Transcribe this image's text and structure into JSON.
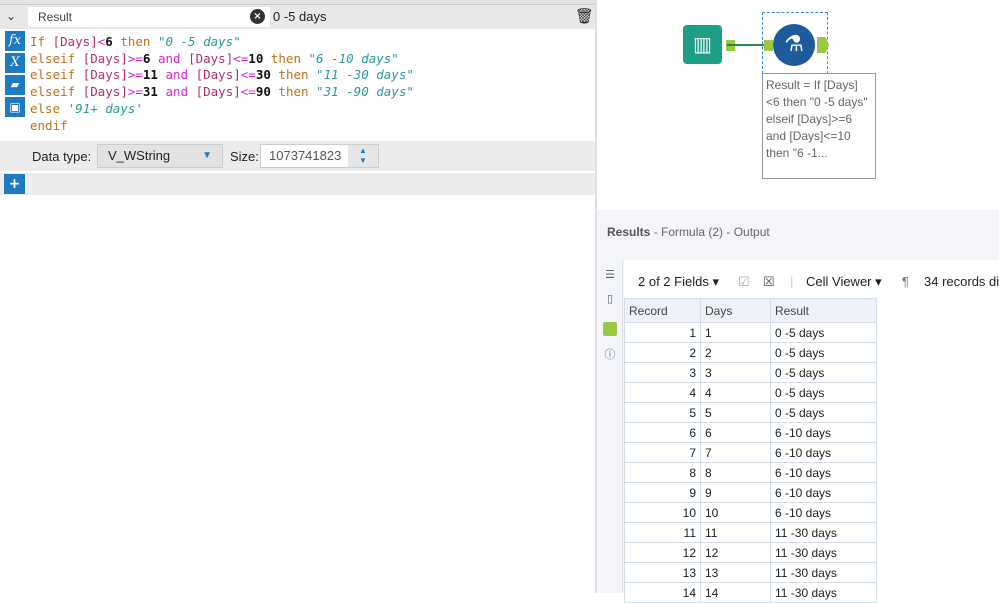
{
  "expression": {
    "field_name": "Result",
    "preview": "0 -5 days",
    "code": [
      [
        [
          "kw",
          "If "
        ],
        [
          "fld",
          "[Days]"
        ],
        [
          "op",
          "<"
        ],
        [
          "num",
          "6"
        ],
        [
          "kw",
          " then "
        ],
        [
          "str",
          "\"0 -5 days\""
        ]
      ],
      [
        [
          "kw",
          "elseif "
        ],
        [
          "fld",
          "[Days]"
        ],
        [
          "op",
          ">="
        ],
        [
          "num",
          "6"
        ],
        [
          "op",
          " and "
        ],
        [
          "fld",
          "[Days]"
        ],
        [
          "op",
          "<="
        ],
        [
          "num",
          "10"
        ],
        [
          "kw",
          " then "
        ],
        [
          "str",
          "\"6 -10 days\""
        ]
      ],
      [
        [
          "kw",
          "elseif "
        ],
        [
          "fld",
          "[Days]"
        ],
        [
          "op",
          ">="
        ],
        [
          "num",
          "11"
        ],
        [
          "op",
          " and "
        ],
        [
          "fld",
          "[Days]"
        ],
        [
          "op",
          "<="
        ],
        [
          "num",
          "30"
        ],
        [
          "kw",
          " then "
        ],
        [
          "str",
          "\"11 -30 days\""
        ]
      ],
      [
        [
          "kw",
          "elseif "
        ],
        [
          "fld",
          "[Days]"
        ],
        [
          "op",
          ">="
        ],
        [
          "num",
          "31"
        ],
        [
          "op",
          " and "
        ],
        [
          "fld",
          "[Days]"
        ],
        [
          "op",
          "<="
        ],
        [
          "num",
          "90"
        ],
        [
          "kw",
          " then "
        ],
        [
          "str",
          "\"31 -90 days\""
        ]
      ],
      [
        [
          "kw",
          "else "
        ],
        [
          "str",
          "'91+ days'"
        ]
      ],
      [
        [
          "kw",
          "endif"
        ]
      ]
    ],
    "data_type_label": "Data type:",
    "data_type": "V_WString",
    "size_label": "Size:",
    "size": "1073741823"
  },
  "canvas": {
    "annotation": "Result = If [Days] <6 then \"0 -5 days\" elseif [Days]>=6 and [Days]<=10 then \"6 -1..."
  },
  "results": {
    "title": "Results",
    "subtitle": " - Formula (2) - Output",
    "fields": "2 of 2 Fields",
    "cell_viewer": "Cell Viewer",
    "records": "34 records di",
    "columns": [
      "Record",
      "Days",
      "Result"
    ],
    "rows": [
      [
        "1",
        "1",
        "0 -5 days"
      ],
      [
        "2",
        "2",
        "0 -5 days"
      ],
      [
        "3",
        "3",
        "0 -5 days"
      ],
      [
        "4",
        "4",
        "0 -5 days"
      ],
      [
        "5",
        "5",
        "0 -5 days"
      ],
      [
        "6",
        "6",
        "6 -10 days"
      ],
      [
        "7",
        "7",
        "6 -10 days"
      ],
      [
        "8",
        "8",
        "6 -10 days"
      ],
      [
        "9",
        "9",
        "6 -10 days"
      ],
      [
        "10",
        "10",
        "6 -10 days"
      ],
      [
        "11",
        "11",
        "11 -30 days"
      ],
      [
        "12",
        "12",
        "11 -30 days"
      ],
      [
        "13",
        "13",
        "11 -30 days"
      ],
      [
        "14",
        "14",
        "11 -30 days"
      ]
    ]
  }
}
